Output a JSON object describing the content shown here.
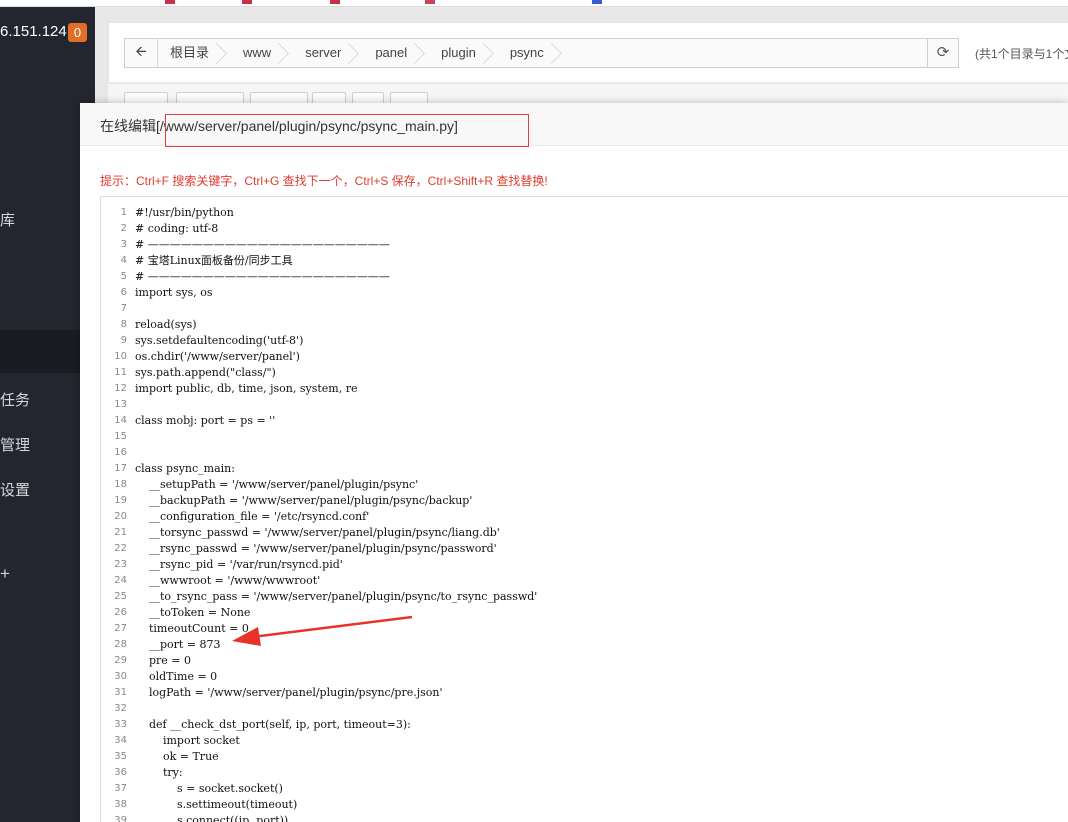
{
  "sidebar": {
    "ip": "6.151.124",
    "badge": "0",
    "items": [
      {
        "label": "库"
      },
      {
        "label": "任务"
      },
      {
        "label": "管理"
      },
      {
        "label": "设置"
      }
    ],
    "plus": "+"
  },
  "pathbar": {
    "crumbs": [
      "根目录",
      "www",
      "server",
      "panel",
      "plugin",
      "psync"
    ],
    "dir_info": "(共1个目录与1个文"
  },
  "dialog": {
    "title_prefix": "在线编辑",
    "title_path": "[/www/server/panel/plugin/psync/psync_main.py]",
    "tip": "提示：Ctrl+F 搜索关键字，Ctrl+G 查找下一个，Ctrl+S 保存，Ctrl+Shift+R 查找替换!"
  },
  "code": [
    {
      "n": "1",
      "t": "#!/usr/bin/python"
    },
    {
      "n": "2",
      "t": "# coding: utf-8"
    },
    {
      "n": "3",
      "t": "# ——————————————————————"
    },
    {
      "n": "4",
      "t": "# 宝塔Linux面板备份/同步工具"
    },
    {
      "n": "5",
      "t": "# ——————————————————————"
    },
    {
      "n": "6",
      "t": "import sys, os"
    },
    {
      "n": "7",
      "t": ""
    },
    {
      "n": "8",
      "t": "reload(sys)"
    },
    {
      "n": "9",
      "t": "sys.setdefaultencoding('utf-8')"
    },
    {
      "n": "10",
      "t": "os.chdir('/www/server/panel')"
    },
    {
      "n": "11",
      "t": "sys.path.append(\"class/\")"
    },
    {
      "n": "12",
      "t": "import public, db, time, json, system, re"
    },
    {
      "n": "13",
      "t": ""
    },
    {
      "n": "14",
      "t": "class mobj: port = ps = ''"
    },
    {
      "n": "15",
      "t": ""
    },
    {
      "n": "16",
      "t": ""
    },
    {
      "n": "17",
      "t": "class psync_main:"
    },
    {
      "n": "18",
      "t": "    __setupPath = '/www/server/panel/plugin/psync'"
    },
    {
      "n": "19",
      "t": "    __backupPath = '/www/server/panel/plugin/psync/backup'"
    },
    {
      "n": "20",
      "t": "    __configuration_file = '/etc/rsyncd.conf'"
    },
    {
      "n": "21",
      "t": "    __torsync_passwd = '/www/server/panel/plugin/psync/liang.db'"
    },
    {
      "n": "22",
      "t": "    __rsync_passwd = '/www/server/panel/plugin/psync/password'"
    },
    {
      "n": "23",
      "t": "    __rsync_pid = '/var/run/rsyncd.pid'"
    },
    {
      "n": "24",
      "t": "    __wwwroot = '/www/wwwroot'"
    },
    {
      "n": "25",
      "t": "    __to_rsync_pass = '/www/server/panel/plugin/psync/to_rsync_passwd'"
    },
    {
      "n": "26",
      "t": "    __toToken = None"
    },
    {
      "n": "27",
      "t": "    timeoutCount = 0"
    },
    {
      "n": "28",
      "t": "    __port = 873"
    },
    {
      "n": "29",
      "t": "    pre = 0"
    },
    {
      "n": "30",
      "t": "    oldTime = 0"
    },
    {
      "n": "31",
      "t": "    logPath = '/www/server/panel/plugin/psync/pre.json'"
    },
    {
      "n": "32",
      "t": ""
    },
    {
      "n": "33",
      "t": "    def __check_dst_port(self, ip, port, timeout=3):"
    },
    {
      "n": "34",
      "t": "        import socket"
    },
    {
      "n": "35",
      "t": "        ok = True"
    },
    {
      "n": "36",
      "t": "        try:"
    },
    {
      "n": "37",
      "t": "            s = socket.socket()"
    },
    {
      "n": "38",
      "t": "            s.settimeout(timeout)"
    },
    {
      "n": "39",
      "t": "            s.connect((ip, port))"
    }
  ]
}
